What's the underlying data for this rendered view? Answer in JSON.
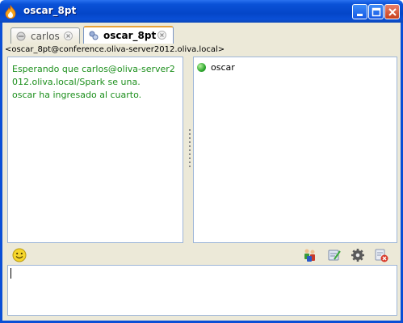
{
  "window": {
    "title": "oscar_8pt",
    "app_icon": "spark-flame-icon",
    "controls": [
      "minimize-icon",
      "maximize-icon",
      "close-icon"
    ]
  },
  "tabs": [
    {
      "label": "carlos",
      "icon": "user-offline-icon",
      "active": false
    },
    {
      "label": "oscar_8pt",
      "icon": "group-chat-icon",
      "active": true
    }
  ],
  "room": {
    "header": "<oscar_8pt@conference.oliva-server2012.oliva.local>"
  },
  "chat": {
    "message_1": "Esperando que carlos@oliva-server2012.oliva.local/Spark se una.",
    "message_2": "oscar ha ingresado al cuarto."
  },
  "occupants": [
    {
      "name": "oscar",
      "status": "online",
      "status_color": "#2ea82e"
    }
  ],
  "toolbar": {
    "left": [
      "emoticon-icon"
    ],
    "right": [
      "invite-users-icon",
      "change-subject-icon",
      "settings-icon",
      "leave-room-icon"
    ]
  },
  "input": {
    "value": ""
  },
  "colors": {
    "chat_text": "#1c8f1c",
    "titlebar": "#0a4fd6",
    "frame": "#ece9d8"
  }
}
